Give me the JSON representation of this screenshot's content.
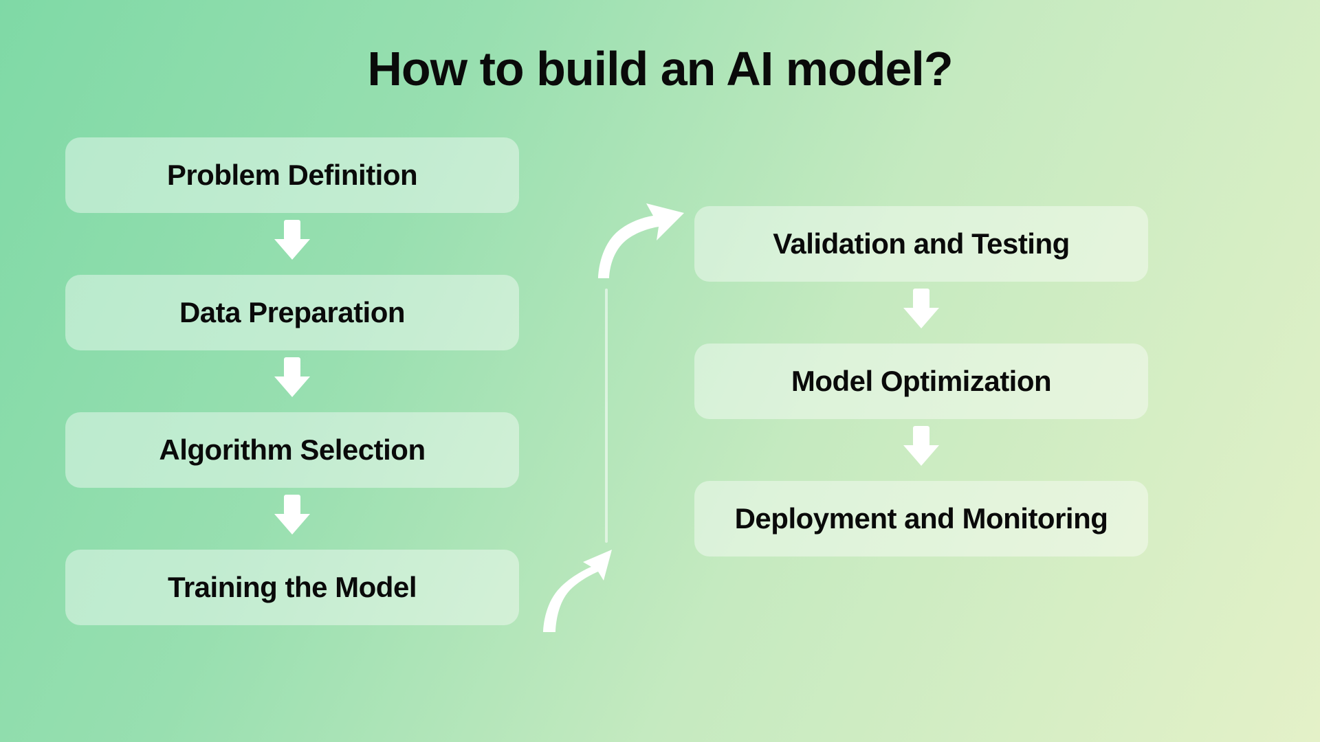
{
  "title": "How to build an AI model?",
  "left_steps": [
    "Problem Definition",
    "Data Preparation",
    "Algorithm Selection",
    "Training the Model"
  ],
  "right_steps": [
    "Validation and Testing",
    "Model Optimization",
    "Deployment and Monitoring"
  ]
}
